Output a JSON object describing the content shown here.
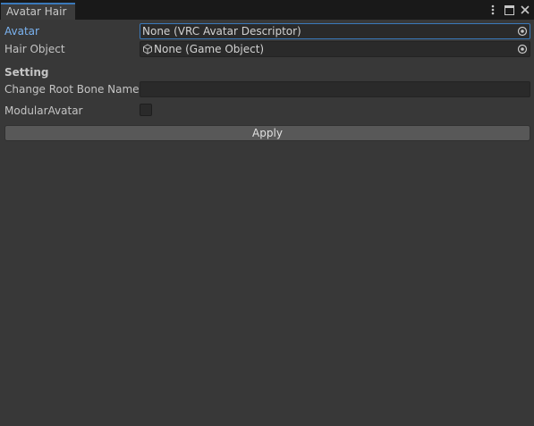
{
  "window": {
    "tab_title": "Avatar Hair"
  },
  "fields": {
    "avatar": {
      "label": "Avatar",
      "value": "None (VRC Avatar Descriptor)"
    },
    "hair_object": {
      "label": "Hair Object",
      "value": "None (Game Object)"
    }
  },
  "setting": {
    "header": "Setting",
    "change_root_bone_name": {
      "label": "Change Root Bone Name",
      "value": ""
    },
    "modular_avatar": {
      "label": "ModularAvatar",
      "checked": false
    }
  },
  "actions": {
    "apply_label": "Apply"
  },
  "icons": {
    "menu": "kebab-menu-icon",
    "maximize": "maximize-icon",
    "close": "close-icon",
    "object_picker": "object-picker-icon",
    "game_object": "cube-icon"
  },
  "colors": {
    "background": "#383838",
    "tabbar": "#191919",
    "field": "#2a2a2a",
    "accent": "#3a79bb",
    "active_label": "#7bb3f0",
    "button": "#585858"
  }
}
